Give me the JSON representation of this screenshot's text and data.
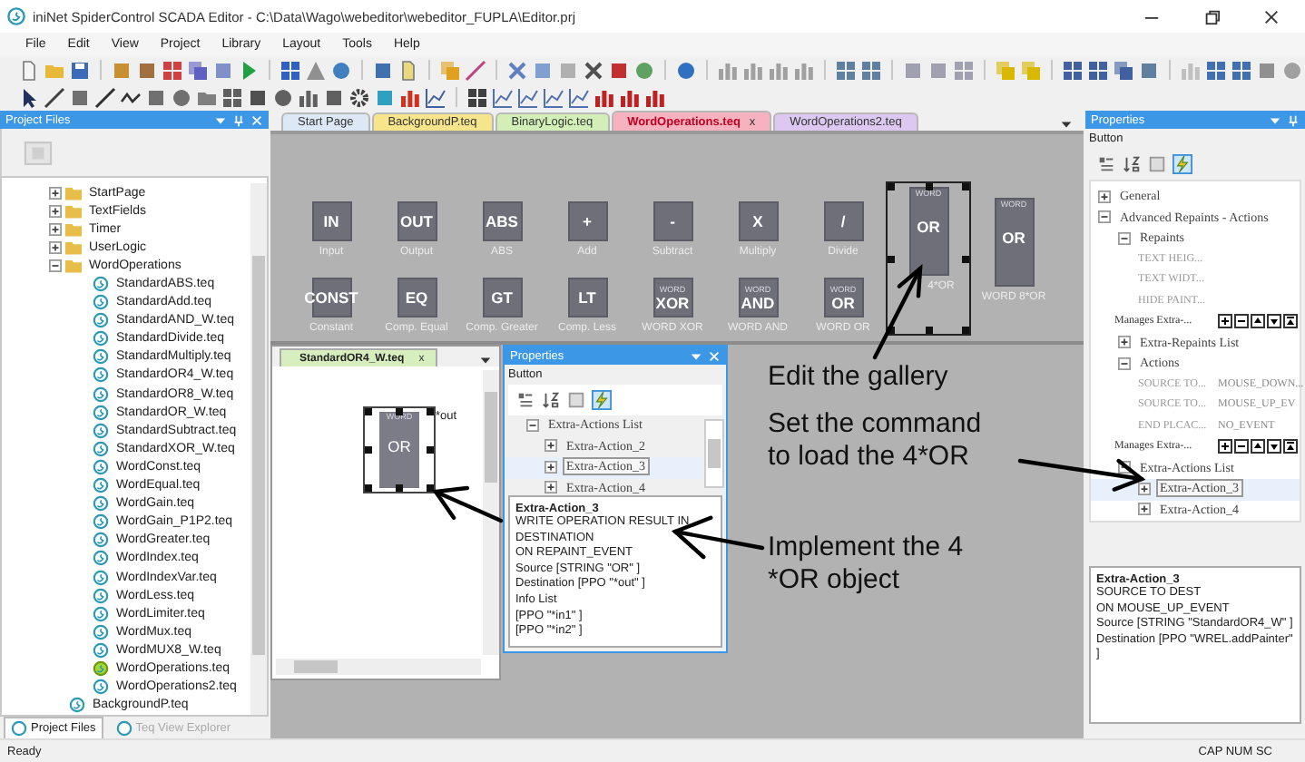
{
  "window": {
    "title": "iniNet SpiderControl SCADA Editor - C:\\Data\\Wago\\webeditor\\webeditor_FUPLA\\Editor.prj"
  },
  "menu": [
    "File",
    "Edit",
    "View",
    "Project",
    "Library",
    "Layout",
    "Tools",
    "Help"
  ],
  "project_files": {
    "title": "Project Files",
    "tree": [
      {
        "label": "StartPage",
        "kind": "folder",
        "expanded": false
      },
      {
        "label": "TextFields",
        "kind": "folder",
        "expanded": false
      },
      {
        "label": "Timer",
        "kind": "folder",
        "expanded": false
      },
      {
        "label": "UserLogic",
        "kind": "folder",
        "expanded": false
      },
      {
        "label": "WordOperations",
        "kind": "folder",
        "expanded": true,
        "children": [
          {
            "label": "StandardABS.teq",
            "kind": "file",
            "active": false
          },
          {
            "label": "StandardAdd.teq",
            "kind": "file",
            "active": false
          },
          {
            "label": "StandardAND_W.teq",
            "kind": "file",
            "active": false
          },
          {
            "label": "StandardDivide.teq",
            "kind": "file",
            "active": false
          },
          {
            "label": "StandardMultiply.teq",
            "kind": "file",
            "active": false
          },
          {
            "label": "StandardOR4_W.teq",
            "kind": "file",
            "active": false
          },
          {
            "label": "StandardOR8_W.teq",
            "kind": "file",
            "active": false
          },
          {
            "label": "StandardOR_W.teq",
            "kind": "file",
            "active": false
          },
          {
            "label": "StandardSubtract.teq",
            "kind": "file",
            "active": false
          },
          {
            "label": "StandardXOR_W.teq",
            "kind": "file",
            "active": false
          },
          {
            "label": "WordConst.teq",
            "kind": "file",
            "active": false
          },
          {
            "label": "WordEqual.teq",
            "kind": "file",
            "active": false
          },
          {
            "label": "WordGain.teq",
            "kind": "file",
            "active": false
          },
          {
            "label": "WordGain_P1P2.teq",
            "kind": "file",
            "active": false
          },
          {
            "label": "WordGreater.teq",
            "kind": "file",
            "active": false
          },
          {
            "label": "WordIndex.teq",
            "kind": "file",
            "active": false
          },
          {
            "label": "WordIndexVar.teq",
            "kind": "file",
            "active": false
          },
          {
            "label": "WordLess.teq",
            "kind": "file",
            "active": false
          },
          {
            "label": "WordLimiter.teq",
            "kind": "file",
            "active": false
          },
          {
            "label": "WordMux.teq",
            "kind": "file",
            "active": false
          },
          {
            "label": "WordMUX8_W.teq",
            "kind": "file",
            "active": false
          },
          {
            "label": "WordOperations.teq",
            "kind": "file",
            "active": true
          },
          {
            "label": "WordOperations2.teq",
            "kind": "file",
            "active": false
          }
        ]
      },
      {
        "label": "BackgroundP.teq",
        "kind": "file",
        "active": false
      }
    ],
    "tabs": [
      {
        "label": "Project Files",
        "selected": true
      },
      {
        "label": "Teq View Explorer",
        "selected": false
      }
    ]
  },
  "editor_tabs": [
    {
      "label": "Start Page",
      "color": "#dce8f6",
      "selected": false
    },
    {
      "label": "BackgroundP.teq",
      "color": "#f7e58c",
      "selected": false
    },
    {
      "label": "BinaryLogic.teq",
      "color": "#d3efb8",
      "selected": false
    },
    {
      "label": "WordOperations.teq",
      "color": "#f6b3bf",
      "selected": true,
      "close": "x"
    },
    {
      "label": "WordOperations2.teq",
      "color": "#dcc8f0",
      "selected": false
    }
  ],
  "gallery": {
    "items": [
      {
        "label": "IN",
        "caption": "Input",
        "kind": "small",
        "selected": false
      },
      {
        "label": "OUT",
        "caption": "Output",
        "kind": "small",
        "selected": false
      },
      {
        "label": "ABS",
        "caption": "ABS",
        "kind": "small",
        "selected": false
      },
      {
        "label": "+",
        "caption": "Add",
        "kind": "small",
        "selected": false
      },
      {
        "label": "-",
        "caption": "Subtract",
        "kind": "small",
        "selected": false
      },
      {
        "label": "X",
        "caption": "Multiply",
        "kind": "small",
        "selected": false
      },
      {
        "label": "/",
        "caption": "Divide",
        "kind": "small",
        "selected": false
      },
      {
        "top": "WORD",
        "label": "OR",
        "caption": "4*OR",
        "kind": "tall",
        "selected": true
      },
      {
        "top": "WORD",
        "label": "OR",
        "caption": "WORD 8*OR",
        "kind": "tall",
        "selected": false
      },
      {
        "label": "CONST",
        "caption": "Constant",
        "kind": "small",
        "selected": false
      },
      {
        "label": "EQ",
        "caption": "Comp. Equal",
        "kind": "small",
        "selected": false
      },
      {
        "label": "GT",
        "caption": "Comp. Greater",
        "kind": "small",
        "selected": false
      },
      {
        "label": "LT",
        "caption": "Comp. Less",
        "kind": "small",
        "selected": false
      },
      {
        "top": "WORD",
        "label": "XOR",
        "caption": "WORD XOR",
        "kind": "small",
        "selected": false
      },
      {
        "top": "WORD",
        "label": "AND",
        "caption": "WORD AND",
        "kind": "small",
        "selected": false
      },
      {
        "top": "WORD",
        "label": "OR",
        "caption": "WORD OR",
        "kind": "small",
        "selected": false
      }
    ]
  },
  "sub_window": {
    "tab": "StandardOR4_W.teq",
    "close": "x",
    "block": {
      "top": "WORD",
      "label": "OR",
      "pin": "*out",
      "selected": true
    }
  },
  "properties_floating": {
    "title": "Properties",
    "object": "Button",
    "views": [
      {
        "kind": "categorized",
        "selected": false
      },
      {
        "kind": "alphabetical",
        "selected": false
      },
      {
        "kind": "pages",
        "selected": false
      },
      {
        "kind": "events",
        "selected": true
      }
    ],
    "rows": [
      {
        "kind": "category",
        "label": "Extra-Actions List",
        "expanded": true,
        "selected": false,
        "children": [
          {
            "kind": "category",
            "label": "Extra-Action_2",
            "expanded": false,
            "selected": false
          },
          {
            "kind": "category",
            "label": "Extra-Action_3",
            "expanded": false,
            "selected": true
          },
          {
            "kind": "category",
            "label": "Extra-Action_4",
            "expanded": false,
            "selected": false
          }
        ]
      }
    ],
    "description": {
      "title": "Extra-Action_3",
      "lines": [
        "WRITE OPERATION RESULT IN DESTINATION",
        "ON REPAINT_EVENT",
        "Source [STRING \"OR\" ]",
        "Destination [PPO \"*out\" ]",
        "Info List",
        "[PPO \"*in1\" ]",
        "[PPO \"*in2\" ]"
      ]
    }
  },
  "annotations": [
    "Edit the gallery",
    "Set the command to load the 4*OR",
    "Implement the 4 *OR object"
  ],
  "properties": {
    "title": "Properties",
    "object": "Button",
    "views": [
      {
        "kind": "categorized",
        "selected": false
      },
      {
        "kind": "alphabetical",
        "selected": false
      },
      {
        "kind": "pages",
        "selected": false
      },
      {
        "kind": "events",
        "selected": true
      }
    ],
    "rows": [
      {
        "kind": "category",
        "label": "General",
        "expanded": false,
        "selected": false
      },
      {
        "kind": "category",
        "label": "Advanced Repaints - Actions",
        "expanded": true,
        "selected": false,
        "children": [
          {
            "kind": "category",
            "label": "Repaints",
            "expanded": true,
            "selected": false,
            "children": [
              {
                "kind": "property",
                "label": "TEXT HEIG...",
                "selected": false
              },
              {
                "kind": "property",
                "label": "TEXT WIDT...",
                "selected": false
              },
              {
                "kind": "property",
                "label": "HIDE PAINT...",
                "selected": false
              }
            ]
          },
          {
            "kind": "manager",
            "label": "Manages Extra-...",
            "selected": false
          },
          {
            "kind": "category",
            "label": "Extra-Repaints List",
            "expanded": false,
            "selected": false
          },
          {
            "kind": "category",
            "label": "Actions",
            "expanded": true,
            "selected": false,
            "children": [
              {
                "kind": "property",
                "label": "SOURCE TO...",
                "value": "MOUSE_DOWN...",
                "selected": false
              },
              {
                "kind": "property",
                "label": "SOURCE TO...",
                "value": "MOUSE_UP_EV",
                "selected": false
              },
              {
                "kind": "property",
                "label": "END PLCAC...",
                "value": "NO_EVENT",
                "selected": false
              }
            ]
          },
          {
            "kind": "manager",
            "label": "Manages Extra-...",
            "selected": false
          },
          {
            "kind": "category",
            "label": "Extra-Actions List",
            "expanded": true,
            "selected": false,
            "children": [
              {
                "kind": "category",
                "label": "Extra-Action_3",
                "expanded": false,
                "selected": true
              },
              {
                "kind": "category",
                "label": "Extra-Action_4",
                "expanded": false,
                "selected": false
              }
            ]
          }
        ]
      }
    ],
    "description": {
      "title": "Extra-Action_3",
      "lines": [
        "SOURCE TO DEST",
        "ON MOUSE_UP_EVENT",
        "Source [STRING \"StandardOR4_W\" ]",
        "Destination [PPO \"WREL.addPainter\" ]"
      ]
    }
  },
  "status_bar": {
    "text": "Ready",
    "indicators": "CAP NUM SC"
  }
}
